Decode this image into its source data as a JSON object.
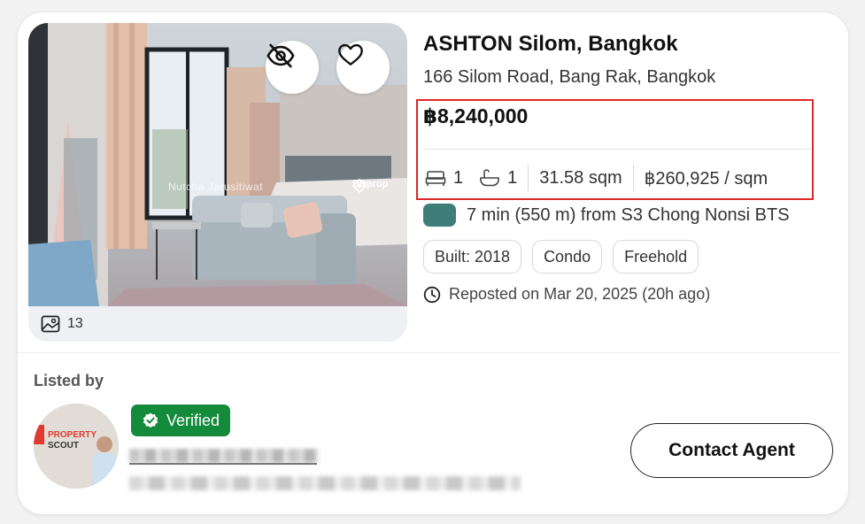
{
  "listing": {
    "title": "ASHTON Silom, Bangkok",
    "address": "166 Silom Road, Bang Rak, Bangkok",
    "price": "฿8,240,000",
    "bedrooms": "1",
    "bathrooms": "1",
    "area": "31.58 sqm",
    "price_per_sqm": "฿260,925 / sqm",
    "transit": "7 min (550 m) from S3 Chong Nonsi BTS",
    "transit_color": "#3f7d7a",
    "tags": [
      "Built: 2018",
      "Condo",
      "Freehold"
    ],
    "reposted": "Reposted on Mar 20, 2025 (20h ago)"
  },
  "photo": {
    "count": "13",
    "watermark": "Nutcha Jarusitiwat",
    "brand": "DDprop",
    "hide_icon": "eye-off-icon",
    "favorite_icon": "heart-icon",
    "gallery_icon": "image-icon"
  },
  "agent": {
    "section_label": "Listed by",
    "verified_label": "Verified",
    "contact_label": "Contact Agent",
    "logo_text": "PROPERTY SCOUT"
  },
  "colors": {
    "highlight_border": "#e02626",
    "verified_bg": "#148a3b"
  }
}
